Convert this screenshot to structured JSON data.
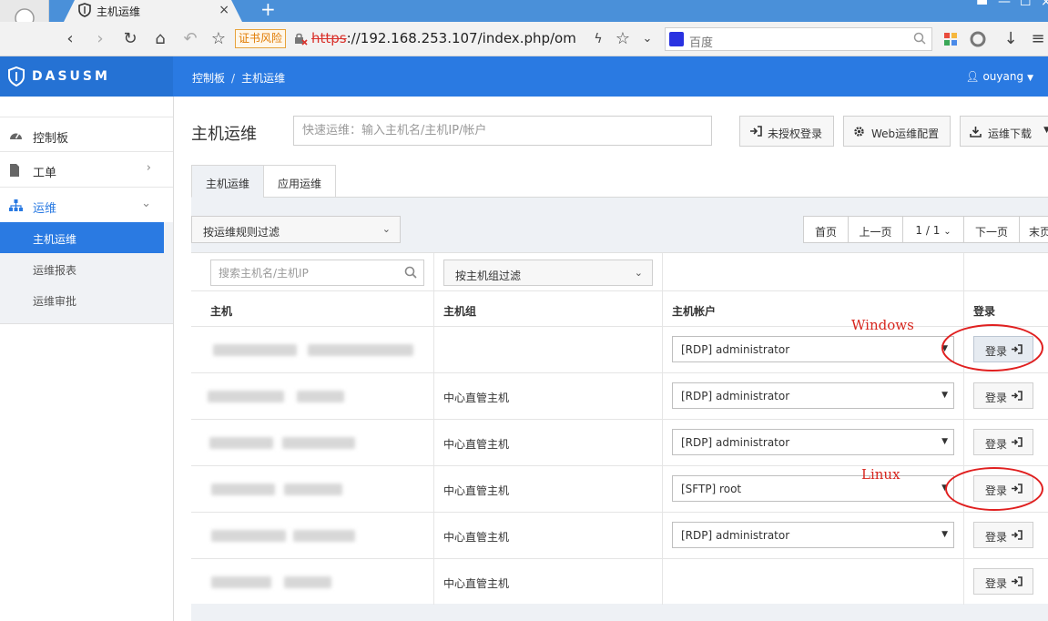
{
  "browser": {
    "tab_title": "主机运维",
    "tab_close": "×",
    "new_tab": "+",
    "risk_badge": "证书风险",
    "url_scheme": "https",
    "url_rest": "://192.168.253.107/index.php/om",
    "search_placeholder": "百度"
  },
  "app": {
    "brand": "DASUSM",
    "breadcrumb": [
      "控制板",
      "主机运维"
    ],
    "breadcrumb_sep": "/",
    "user": "ouyang"
  },
  "sidebar": {
    "items": [
      {
        "label": "控制板",
        "icon": "dashboard-icon"
      },
      {
        "label": "工单",
        "icon": "document-icon",
        "chevron": "›"
      },
      {
        "label": "运维",
        "icon": "sitemap-icon",
        "chevron": "⌄"
      }
    ],
    "subitems": [
      "主机运维",
      "运维报表",
      "运维审批"
    ]
  },
  "main": {
    "title": "主机运维",
    "quick_search_placeholder": "快速运维：输入主机名/主机IP/帐户",
    "buttons": {
      "unauth_login": "未授权登录",
      "web_config": "Web运维配置",
      "download": "运维下载"
    },
    "tabs": [
      "主机运维",
      "应用运维"
    ],
    "rule_filter": "按运维规则过滤",
    "pager": {
      "first": "首页",
      "prev": "上一页",
      "current": "1 / 1",
      "next": "下一页",
      "last": "末页"
    },
    "table": {
      "search_placeholder": "搜索主机名/主机IP",
      "group_filter": "按主机组过滤",
      "headers": [
        "主机",
        "主机组",
        "主机帐户",
        "登录"
      ],
      "login_label": "登录",
      "rows": [
        {
          "group": "",
          "account": "[RDP] administrator"
        },
        {
          "group": "中心直管主机",
          "account": "[RDP] administrator"
        },
        {
          "group": "中心直管主机",
          "account": "[RDP] administrator"
        },
        {
          "group": "中心直管主机",
          "account": "[SFTP] root"
        },
        {
          "group": "中心直管主机",
          "account": "[RDP] administrator"
        },
        {
          "group": "中心直管主机",
          "account": ""
        }
      ]
    }
  },
  "annotations": {
    "windows": "Windows",
    "linux": "Linux"
  },
  "colors": {
    "brand_blue": "#2a7ae2",
    "annotation_red": "#e02020"
  }
}
